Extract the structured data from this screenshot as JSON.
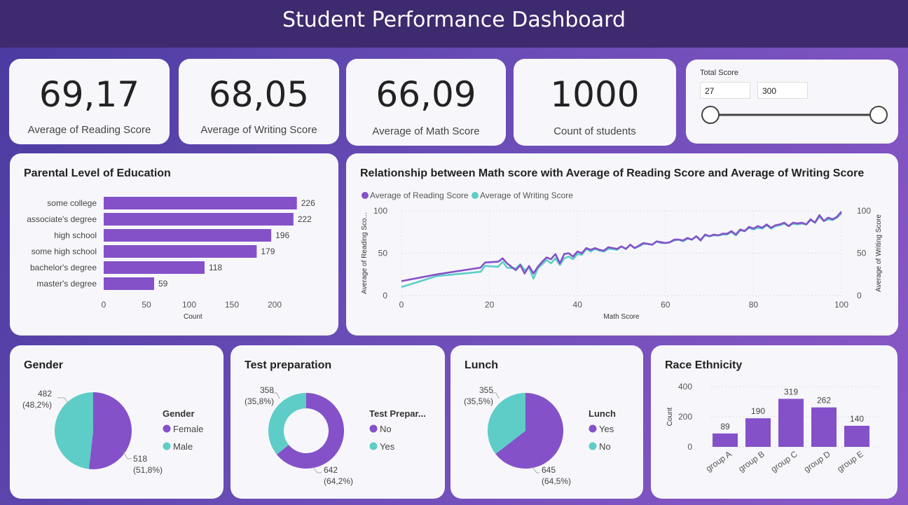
{
  "header": {
    "title": "Student Performance Dashboard"
  },
  "kpis": [
    {
      "value": "69,17",
      "label": "Average of Reading Score"
    },
    {
      "value": "68,05",
      "label": "Average of Writing Score"
    },
    {
      "value": "66,09",
      "label": "Average of Math Score"
    },
    {
      "value": "1000",
      "label": "Count of students"
    }
  ],
  "slicer": {
    "title": "Total Score",
    "min": "27",
    "max": "300"
  },
  "colors": {
    "purple": "#8451c9",
    "teal": "#5ecdc7"
  },
  "chart_data": [
    {
      "id": "parental",
      "type": "bar",
      "orientation": "horizontal",
      "title": "Parental Level of Education",
      "xlabel": "Count",
      "categories": [
        "some college",
        "associate's degree",
        "high school",
        "some high school",
        "bachelor's degree",
        "master's degree"
      ],
      "values": [
        226,
        222,
        196,
        179,
        118,
        59
      ],
      "xlim": [
        0,
        230
      ],
      "xticks": [
        0,
        50,
        100,
        150,
        200
      ]
    },
    {
      "id": "relationship",
      "type": "line",
      "title": "Relationship between Math score with Average of Reading Score and Average of Writing Score",
      "xlabel": "Math Score",
      "ylabel_left": "Average of Reading Sco...",
      "ylabel_right": "Average of Writing Score",
      "xlim": [
        0,
        100
      ],
      "ylim": [
        0,
        100
      ],
      "xticks": [
        0,
        20,
        40,
        60,
        80,
        100
      ],
      "yticks": [
        0,
        50,
        100
      ],
      "x": [
        0,
        8,
        18,
        19,
        22,
        23,
        24,
        26,
        27,
        28,
        29,
        30,
        31,
        32,
        33,
        34,
        35,
        36,
        37,
        38,
        39,
        40,
        41,
        42,
        43,
        44,
        45,
        46,
        47,
        48,
        49,
        50,
        51,
        52,
        53,
        54,
        55,
        56,
        57,
        58,
        59,
        60,
        61,
        62,
        63,
        64,
        65,
        66,
        67,
        68,
        69,
        70,
        71,
        72,
        73,
        74,
        75,
        76,
        77,
        78,
        79,
        80,
        81,
        82,
        83,
        84,
        85,
        86,
        87,
        88,
        89,
        90,
        91,
        92,
        93,
        94,
        95,
        96,
        97,
        98,
        99,
        100
      ],
      "series": [
        {
          "name": "Average of Reading Score",
          "values": [
            17,
            25,
            33,
            39,
            40,
            44,
            38,
            30,
            36,
            26,
            35,
            26,
            34,
            40,
            45,
            43,
            49,
            38,
            49,
            50,
            46,
            52,
            50,
            56,
            54,
            56,
            54,
            53,
            57,
            56,
            55,
            58,
            55,
            60,
            56,
            59,
            62,
            61,
            60,
            64,
            63,
            62,
            63,
            66,
            66,
            65,
            68,
            66,
            70,
            65,
            72,
            70,
            72,
            71,
            73,
            73,
            76,
            72,
            78,
            76,
            81,
            79,
            82,
            80,
            84,
            80,
            83,
            84,
            86,
            82,
            86,
            85,
            86,
            84,
            90,
            86,
            95,
            88,
            92,
            90,
            93,
            99
          ]
        },
        {
          "name": "Average of Writing Score",
          "values": [
            10,
            23,
            28,
            35,
            34,
            40,
            33,
            32,
            37,
            30,
            33,
            20,
            32,
            37,
            42,
            38,
            44,
            36,
            44,
            46,
            43,
            49,
            48,
            55,
            52,
            55,
            53,
            52,
            55,
            55,
            54,
            58,
            55,
            60,
            56,
            58,
            61,
            61,
            60,
            64,
            62,
            62,
            63,
            65,
            66,
            64,
            67,
            66,
            70,
            66,
            71,
            70,
            71,
            71,
            72,
            72,
            75,
            71,
            77,
            76,
            80,
            78,
            80,
            79,
            83,
            79,
            82,
            83,
            85,
            82,
            85,
            84,
            85,
            84,
            89,
            86,
            93,
            88,
            90,
            89,
            92,
            97
          ]
        }
      ],
      "legend": "top-left"
    },
    {
      "id": "gender",
      "type": "pie",
      "title": "Gender",
      "legend_title": "Gender",
      "categories": [
        "Female",
        "Male"
      ],
      "values": [
        518,
        482
      ],
      "labels": [
        "518\n(51,8%)",
        "482\n(48,2%)"
      ]
    },
    {
      "id": "test",
      "type": "pie",
      "variant": "donut",
      "title": "Test preparation",
      "legend_title": "Test Prepar...",
      "categories": [
        "No",
        "Yes"
      ],
      "values": [
        642,
        358
      ],
      "labels": [
        "642\n(64,2%)",
        "358\n(35,8%)"
      ]
    },
    {
      "id": "lunch",
      "type": "pie",
      "title": "Lunch",
      "legend_title": "Lunch",
      "categories": [
        "Yes",
        "No"
      ],
      "values": [
        645,
        355
      ],
      "labels": [
        "645\n(64,5%)",
        "355\n(35,5%)"
      ]
    },
    {
      "id": "race",
      "type": "bar",
      "title": "Race Ethnicity",
      "ylabel": "Count",
      "categories": [
        "group A",
        "group B",
        "group C",
        "group D",
        "group E"
      ],
      "values": [
        89,
        190,
        319,
        262,
        140
      ],
      "ylim": [
        0,
        400
      ],
      "yticks": [
        0,
        200,
        400
      ]
    }
  ]
}
